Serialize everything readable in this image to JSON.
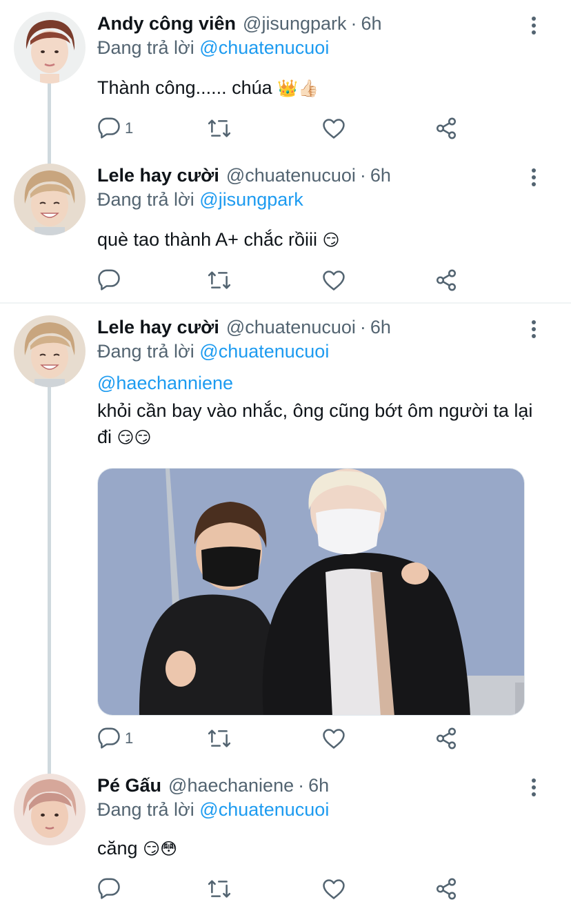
{
  "tweets": [
    {
      "name": "Andy công viên",
      "handle": "@jisungpark",
      "sep": "·",
      "time": "6h",
      "replying_prefix": "Đang trả lời",
      "replying_to": "@chuatenucuoi",
      "text": "Thành công...... chúa",
      "emoji": "👑👍🏻",
      "reply_count": "1",
      "avatar_color": "#e9d6cc"
    },
    {
      "name": "Lele hay cười",
      "handle": "@chuatenucuoi",
      "sep": "·",
      "time": "6h",
      "replying_prefix": "Đang trả lời",
      "replying_to": "@jisungpark",
      "text": "què tao thành A+ chắc rồiii",
      "emoji": "😏",
      "reply_count": "",
      "avatar_color": "#d8c8b4"
    },
    {
      "name": "Lele hay cười",
      "handle": "@chuatenucuoi",
      "sep": "·",
      "time": "6h",
      "replying_prefix": "Đang trả lời",
      "replying_to": "@chuatenucuoi",
      "mention_line": "@haechanniene",
      "text": "khỏi cần bay vào nhắc, ông cũng bớt ôm người ta lại đi",
      "emoji": "😏😏",
      "reply_count": "1",
      "avatar_color": "#d8c8b4"
    },
    {
      "name": "Pé Gấu",
      "handle": "@haechaniene",
      "sep": "·",
      "time": "6h",
      "replying_prefix": "Đang trả lời",
      "replying_to": "@chuatenucuoi",
      "text": "căng",
      "emoji": "😏😳",
      "reply_count": "",
      "avatar_color": "#e2c2b8"
    }
  ],
  "icons": {
    "reply": "reply-icon",
    "retweet": "retweet-icon",
    "like": "like-icon",
    "share": "share-icon",
    "more": "more-icon"
  },
  "colors": {
    "link": "#1d9bf0",
    "muted": "#536471",
    "thread_line": "#cfd9de"
  }
}
